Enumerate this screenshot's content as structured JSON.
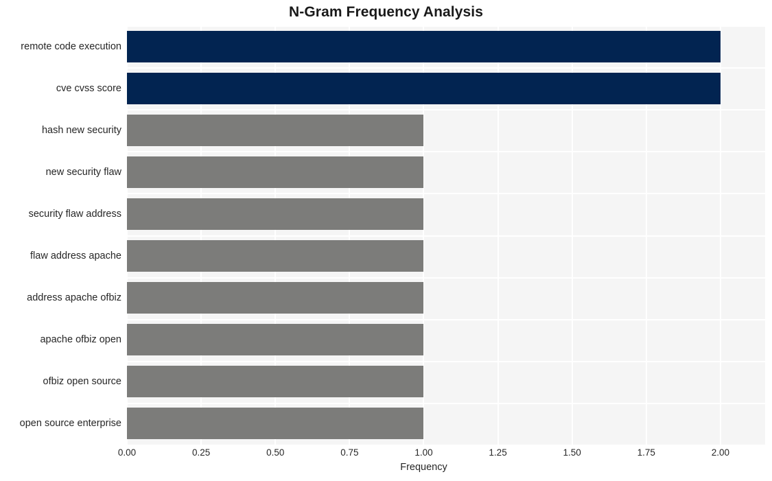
{
  "chart_data": {
    "type": "bar",
    "orientation": "horizontal",
    "title": "N-Gram Frequency Analysis",
    "xlabel": "Frequency",
    "ylabel": "",
    "xlim": [
      0,
      2.1505
    ],
    "grid": true,
    "legend": "none",
    "xticks": [
      "0.00",
      "0.25",
      "0.50",
      "0.75",
      "1.00",
      "1.25",
      "1.50",
      "1.75",
      "2.00"
    ],
    "xtick_values": [
      0,
      0.25,
      0.5,
      0.75,
      1.0,
      1.25,
      1.5,
      1.75,
      2.0
    ],
    "categories": [
      "remote code execution",
      "cve cvss score",
      "hash new security",
      "new security flaw",
      "security flaw address",
      "flaw address apache",
      "address apache ofbiz",
      "apache ofbiz open",
      "ofbiz open source",
      "open source enterprise"
    ],
    "values": [
      2,
      2,
      1,
      1,
      1,
      1,
      1,
      1,
      1,
      1
    ],
    "bar_colors": [
      "#022451",
      "#022451",
      "#7c7c7a",
      "#7c7c7a",
      "#7c7c7a",
      "#7c7c7a",
      "#7c7c7a",
      "#7c7c7a",
      "#7c7c7a",
      "#7c7c7a"
    ],
    "colors": {
      "highlight_bar": "#022451",
      "normal_bar": "#7c7c7a",
      "plot_background": "#f5f5f5",
      "figure_background": "#ffffff",
      "gridline": "#ffffff",
      "text": "#262626",
      "title_text": "#1a1a1a"
    }
  }
}
